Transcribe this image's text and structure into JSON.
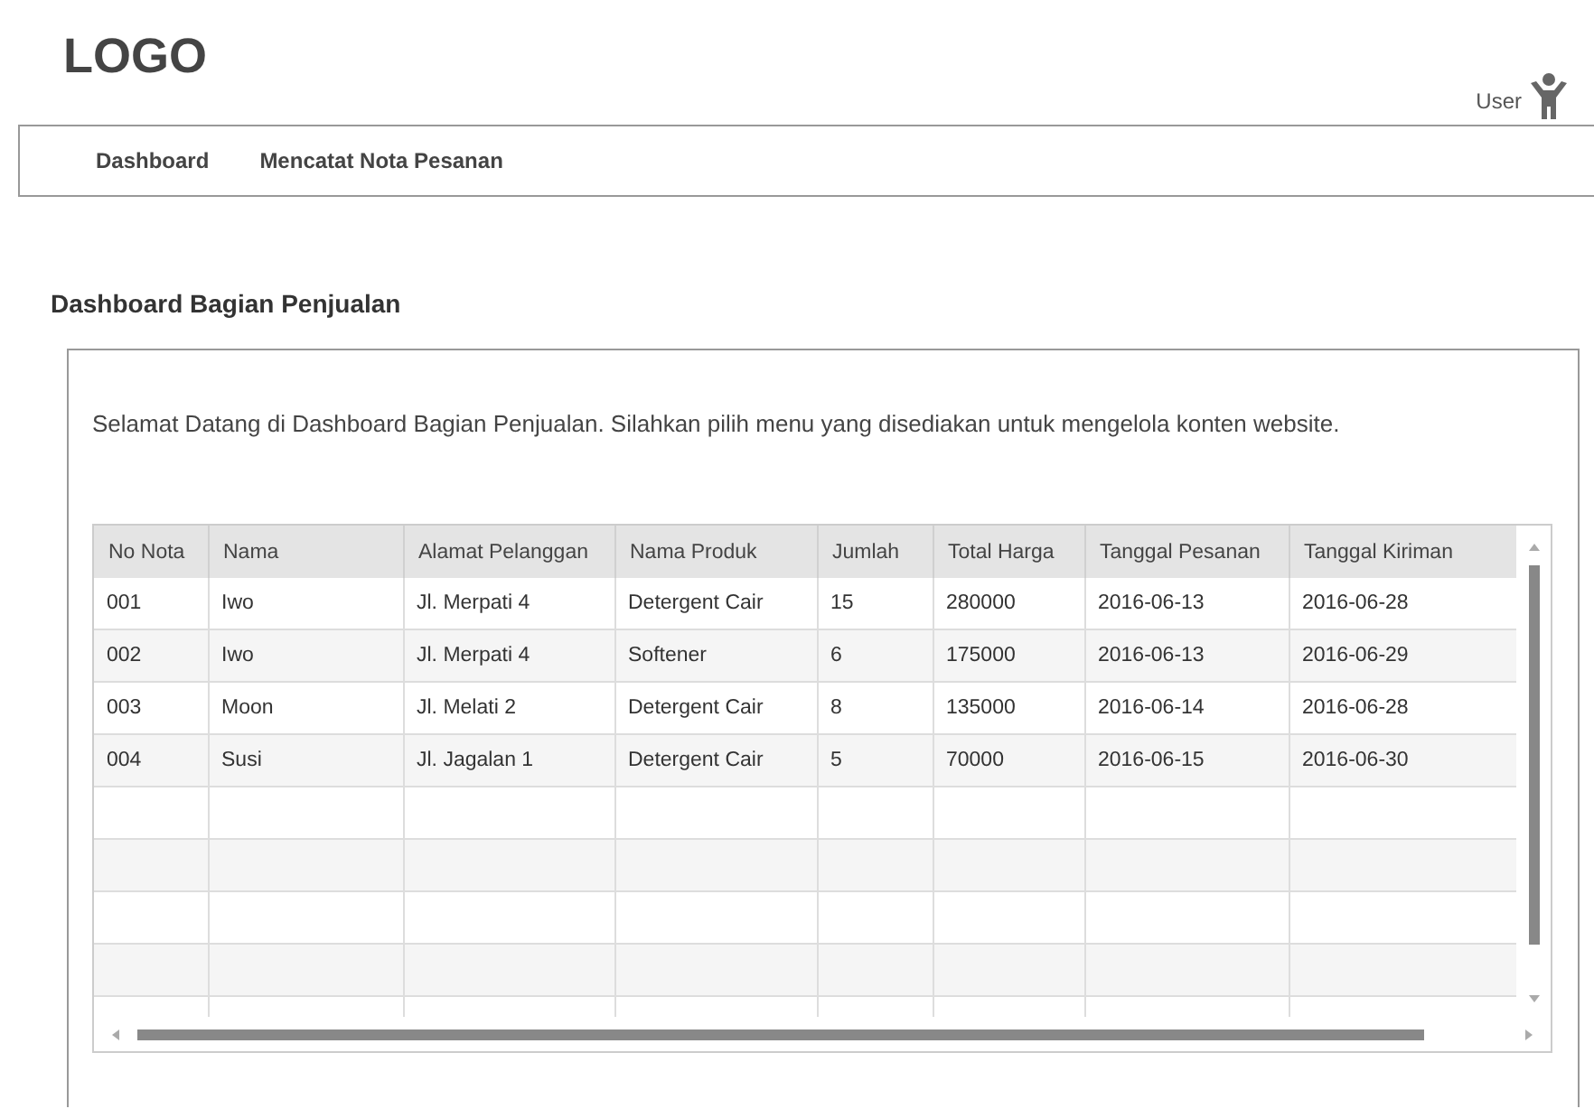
{
  "header": {
    "logo": "LOGO",
    "user": "User"
  },
  "nav": {
    "items": [
      "Dashboard",
      "Mencatat Nota Pesanan"
    ]
  },
  "page_title": "Dashboard Bagian Penjualan",
  "welcome": "Selamat Datang di Dashboard Bagian Penjualan. Silahkan pilih menu yang disediakan untuk mengelola konten website.",
  "table": {
    "columns": [
      "No Nota",
      "Nama",
      "Alamat Pelanggan",
      "Nama Produk",
      "Jumlah",
      "Total Harga",
      "Tanggal Pesanan",
      "Tanggal Kiriman"
    ],
    "rows": [
      [
        "001",
        "Iwo",
        "Jl. Merpati 4",
        "Detergent Cair",
        "15",
        "280000",
        "2016-06-13",
        "2016-06-28"
      ],
      [
        "002",
        "Iwo",
        "Jl. Merpati 4",
        "Softener",
        "6",
        "175000",
        "2016-06-13",
        "2016-06-29"
      ],
      [
        "003",
        "Moon",
        "Jl. Melati 2",
        "Detergent Cair",
        "8",
        "135000",
        "2016-06-14",
        "2016-06-28"
      ],
      [
        "004",
        "Susi",
        "Jl. Jagalan 1",
        "Detergent Cair",
        "5",
        "70000",
        "2016-06-15",
        "2016-06-30"
      ]
    ]
  }
}
